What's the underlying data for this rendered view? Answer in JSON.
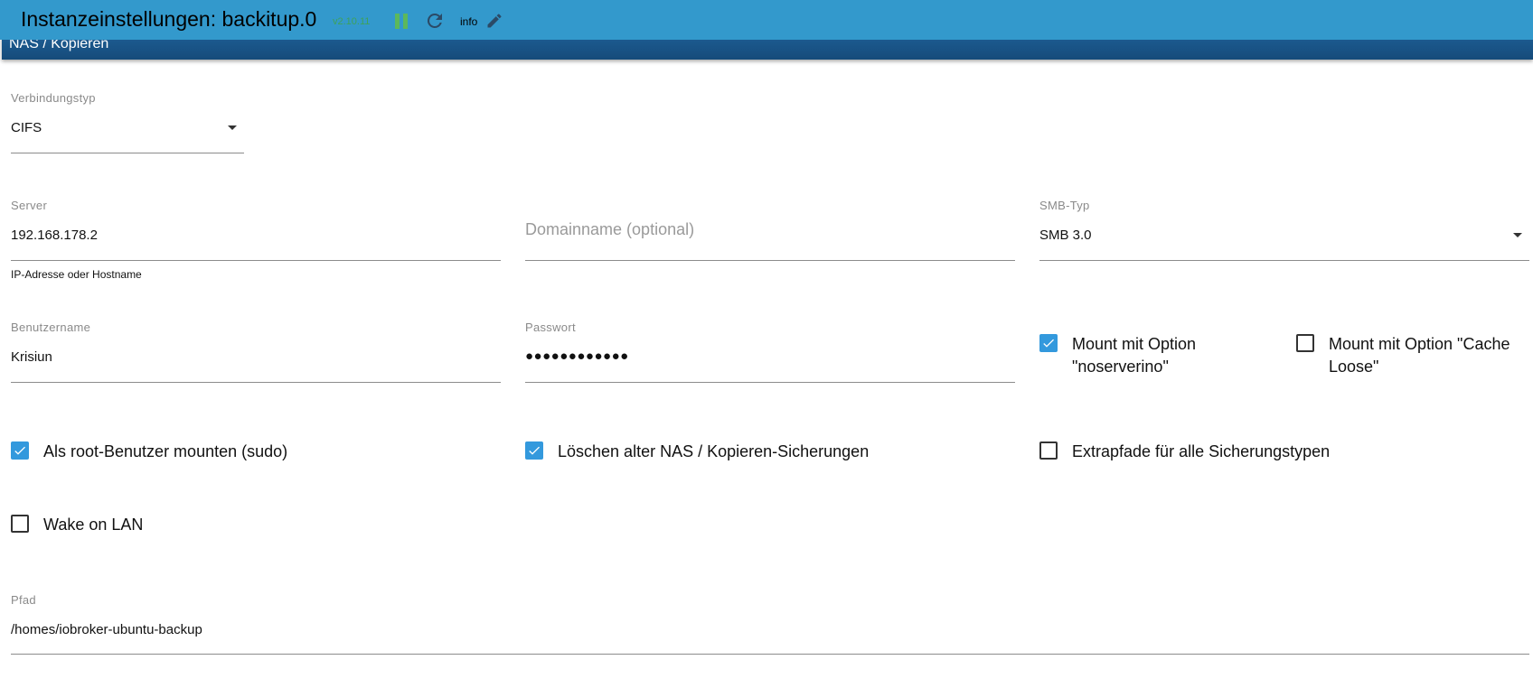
{
  "header": {
    "title": "Instanzeinstellungen: backitup.0",
    "version": "v2.10.11",
    "info_label": "info"
  },
  "tab": {
    "label": "NAS / Kopieren"
  },
  "form": {
    "connection_type": {
      "label": "Verbindungstyp",
      "value": "CIFS"
    },
    "server": {
      "label": "Server",
      "value": "192.168.178.2",
      "helper": "IP-Adresse oder Hostname"
    },
    "domain": {
      "placeholder": "Domainname (optional)"
    },
    "smb_type": {
      "label": "SMB-Typ",
      "value": "SMB 3.0"
    },
    "username": {
      "label": "Benutzername",
      "value": "Krisiun"
    },
    "password": {
      "label": "Passwort",
      "value": "●●●●●●●●●●●●"
    },
    "noserverino": {
      "label": "Mount mit Option \"noserverino\"",
      "checked": true
    },
    "cache_loose": {
      "label": "Mount mit Option \"Cache Loose\"",
      "checked": false
    },
    "sudo": {
      "label": "Als root-Benutzer mounten (sudo)",
      "checked": true
    },
    "delete_old": {
      "label": "Löschen alter NAS / Kopieren-Sicherungen",
      "checked": true
    },
    "extra_paths": {
      "label": "Extrapfade für alle Sicherungstypen",
      "checked": false
    },
    "wake_on_lan": {
      "label": "Wake on LAN",
      "checked": false
    },
    "path": {
      "label": "Pfad",
      "value": "/homes/iobroker-ubuntu-backup"
    }
  },
  "colors": {
    "header_bg": "#3399cc",
    "tab_bg": "#1d5f96",
    "checkbox_on": "#3399dd",
    "version_green": "#3fa34d",
    "pause_green": "#5cb85c"
  },
  "icons": {
    "pause": "pause-icon",
    "refresh": "refresh-icon",
    "edit": "pencil-icon",
    "dropdown": "caret-down-icon",
    "check": "checkmark-icon"
  }
}
